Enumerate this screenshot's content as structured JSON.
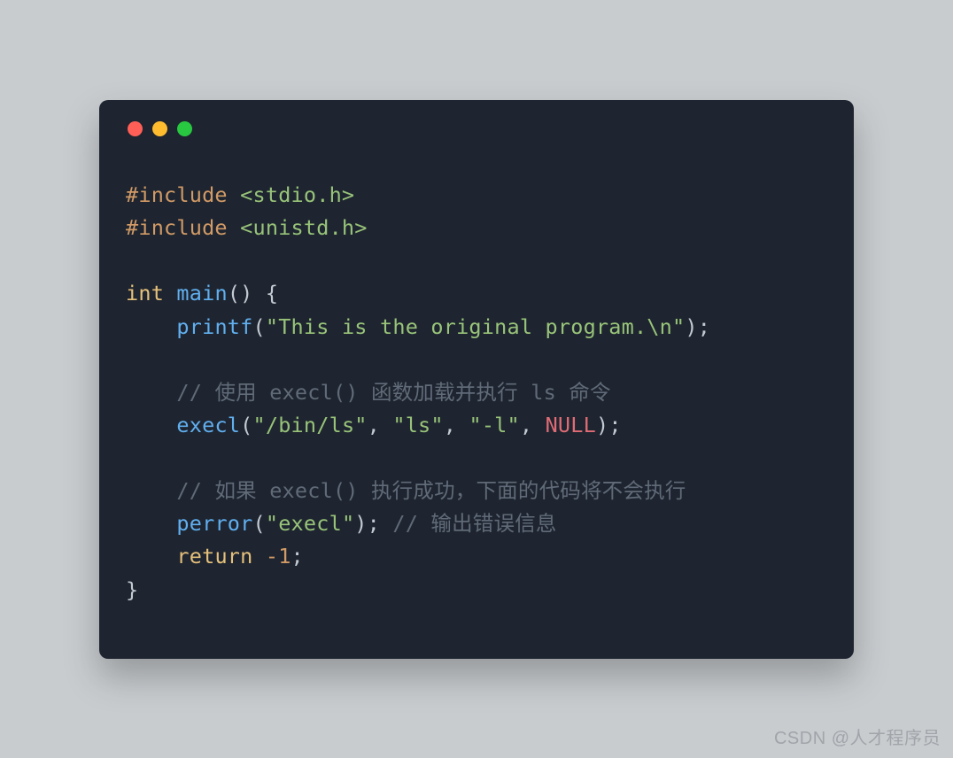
{
  "colors": {
    "bg": "#c8cccf",
    "window": "#1e2530",
    "red": "#ff5f57",
    "yellow": "#febc2e",
    "green": "#28c840"
  },
  "code": {
    "include1_dir": "#include",
    "include1_lib": " <stdio.h>",
    "include2_dir": "#include",
    "include2_lib": " <unistd.h>",
    "int": "int",
    "main": "main",
    "paren_open": "(",
    "paren_close": ")",
    "brace_open": " {",
    "indent": "    ",
    "printf": "printf",
    "printf_arg": "\"This is the original program.\\n\"",
    "semi": ";",
    "cmt1": "// 使用 execl() 函数加载并执行 ls 命令",
    "execl": "execl",
    "execl_a1": "\"/bin/ls\"",
    "comma_sp": ", ",
    "execl_a2": "\"ls\"",
    "execl_a3": "\"-l\"",
    "null": "NULL",
    "cmt2": "// 如果 execl() 执行成功，下面的代码将不会执行",
    "perror": "perror",
    "perror_arg": "\"execl\"",
    "cmt3": " // 输出错误信息",
    "return": "return",
    "neg1": " -1",
    "brace_close": "}"
  },
  "watermark": "CSDN @人才程序员"
}
